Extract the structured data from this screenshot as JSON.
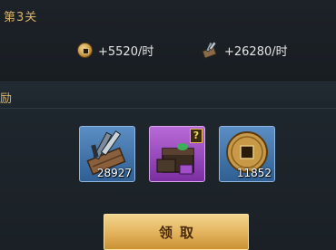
{
  "stage": {
    "title": "第3关"
  },
  "income": [
    {
      "icon": "copper-coin-icon",
      "text": "+5520/时"
    },
    {
      "icon": "supply-crate-icon",
      "text": "+26280/时"
    }
  ],
  "rewards": {
    "header": "励",
    "items": [
      {
        "icon": "supply-crate-icon",
        "count": "28927",
        "rarity": "blue"
      },
      {
        "icon": "mystery-chest-icon",
        "count": "",
        "rarity": "purple",
        "badge": "?"
      },
      {
        "icon": "copper-coin-icon",
        "count": "11852",
        "rarity": "blue"
      }
    ]
  },
  "claim_button": {
    "label": "领取"
  },
  "colors": {
    "accent_gold": "#d8b36a",
    "background": "#1e242a",
    "button_gold": "#e2b25c",
    "rarity_blue": "#2f5f93",
    "rarity_purple": "#7a2fa0"
  }
}
